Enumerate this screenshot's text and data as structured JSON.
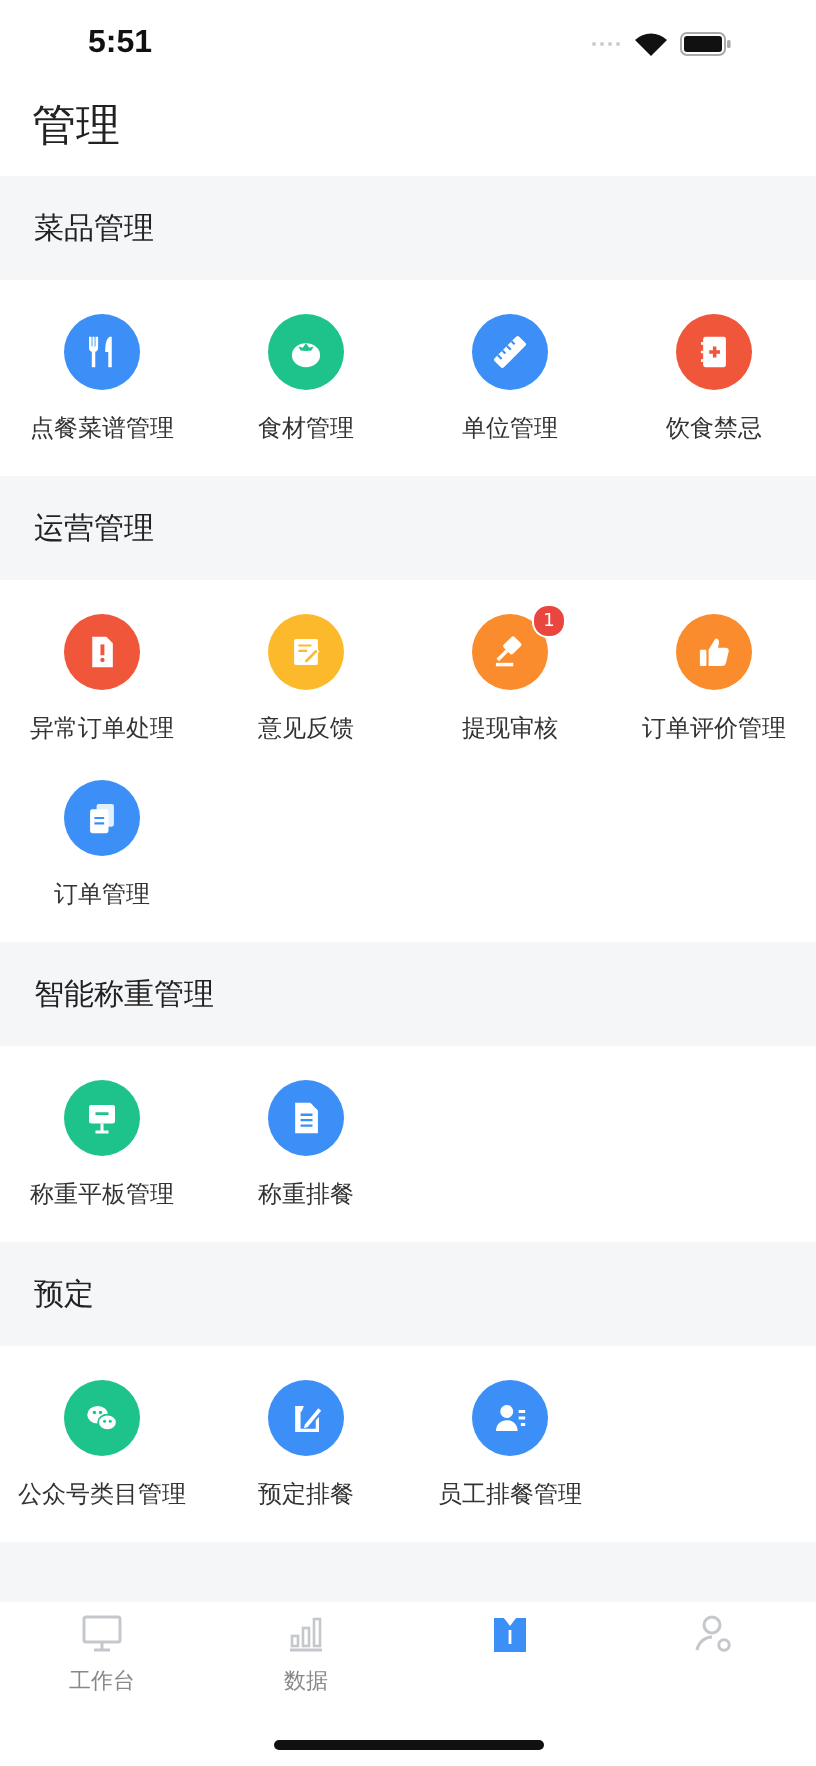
{
  "status_bar": {
    "time": "5:51"
  },
  "page_title": "管理",
  "sections": [
    {
      "title": "菜品管理",
      "items": [
        {
          "label": "点餐菜谱管理",
          "kind": "fork-knife",
          "color": "#3b8ff6"
        },
        {
          "label": "食材管理",
          "kind": "tomato",
          "color": "#1ec38b"
        },
        {
          "label": "单位管理",
          "kind": "ruler",
          "color": "#3b8ff6"
        },
        {
          "label": "饮食禁忌",
          "kind": "book-plus",
          "color": "#f0563a"
        }
      ]
    },
    {
      "title": "运营管理",
      "items": [
        {
          "label": "异常订单处理",
          "kind": "alert-doc",
          "color": "#f0563a"
        },
        {
          "label": "意见反馈",
          "kind": "edit-note",
          "color": "#fdb92c"
        },
        {
          "label": "提现审核",
          "kind": "gavel",
          "color": "#fb8c2d",
          "badge": "1"
        },
        {
          "label": "订单评价管理",
          "kind": "thumbs-up",
          "color": "#fb8c2d"
        },
        {
          "label": "订单管理",
          "kind": "documents",
          "color": "#3b8ff6"
        }
      ]
    },
    {
      "title": "智能称重管理",
      "items": [
        {
          "label": "称重平板管理",
          "kind": "monitor-stand",
          "color": "#1ec38b"
        },
        {
          "label": "称重排餐",
          "kind": "document",
          "color": "#3b8ff6"
        }
      ]
    },
    {
      "title": "预定",
      "items": [
        {
          "label": "公众号类目管理",
          "kind": "chat",
          "color": "#1ec38b"
        },
        {
          "label": "预定排餐",
          "kind": "doc-pen",
          "color": "#3b8ff6"
        },
        {
          "label": "员工排餐管理",
          "kind": "person-list",
          "color": "#3b8ff6"
        }
      ]
    }
  ],
  "tab_bar": [
    {
      "label": "工作台",
      "kind": "monitor",
      "selected": false
    },
    {
      "label": "数据",
      "kind": "bar-chart",
      "selected": false
    },
    {
      "kind": "shirt",
      "selected": true
    },
    {
      "kind": "person-gear",
      "selected": false
    }
  ]
}
